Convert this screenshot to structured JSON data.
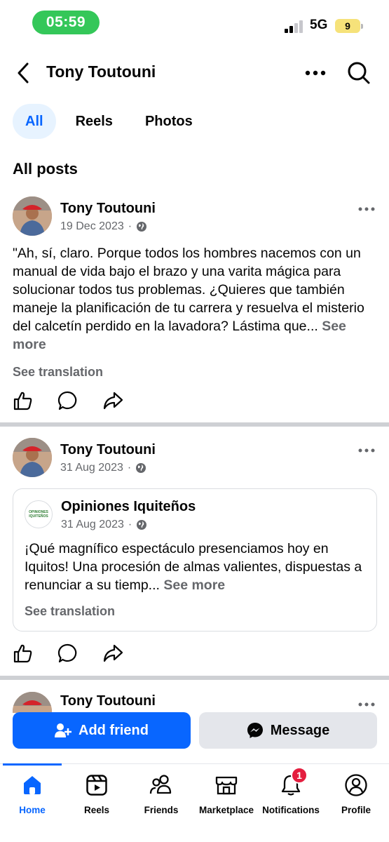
{
  "status_bar": {
    "time": "05:59",
    "network": "5G",
    "battery": "9"
  },
  "header": {
    "title": "Tony Toutouni"
  },
  "tabs": [
    {
      "label": "All",
      "active": true
    },
    {
      "label": "Reels",
      "active": false
    },
    {
      "label": "Photos",
      "active": false
    }
  ],
  "section_title": "All posts",
  "posts": [
    {
      "author": "Tony Toutouni",
      "date": "19 Dec 2023",
      "text": "\"Ah, sí, claro. Porque todos los hombres nacemos con un manual de vida bajo el brazo y una varita mágica para solucionar todos tus problemas. ¿Quieres que también maneje la planificación de tu carrera y resuelva el misterio del calcetín perdido en la lavadora? Lástima que...",
      "see_more": "See more",
      "see_translation": "See translation"
    },
    {
      "author": "Tony Toutouni",
      "date": "31 Aug 2023",
      "shared": {
        "page_name": "Opiniones Iquiteños",
        "logo_text": "OPINIONES IQUITEÑOS",
        "date": "31 Aug 2023",
        "text": "¡Qué magnífico espectáculo presenciamos hoy en Iquitos! Una procesión de almas valientes, dispuestas a renunciar a su tiemp...",
        "see_more": "See more",
        "see_translation": "See translation"
      }
    },
    {
      "author": "Tony Toutouni"
    }
  ],
  "buttons": {
    "add_friend": "Add friend",
    "message": "Message"
  },
  "tabbar": [
    {
      "label": "Home",
      "icon": "home-icon",
      "active": true
    },
    {
      "label": "Reels",
      "icon": "reels-icon"
    },
    {
      "label": "Friends",
      "icon": "friends-icon"
    },
    {
      "label": "Marketplace",
      "icon": "marketplace-icon"
    },
    {
      "label": "Notifications",
      "icon": "bell-icon",
      "badge": "1"
    },
    {
      "label": "Profile",
      "icon": "profile-icon"
    }
  ],
  "colors": {
    "accent": "#0866ff",
    "badge": "#e41e3f",
    "status_pill": "#34c759"
  }
}
